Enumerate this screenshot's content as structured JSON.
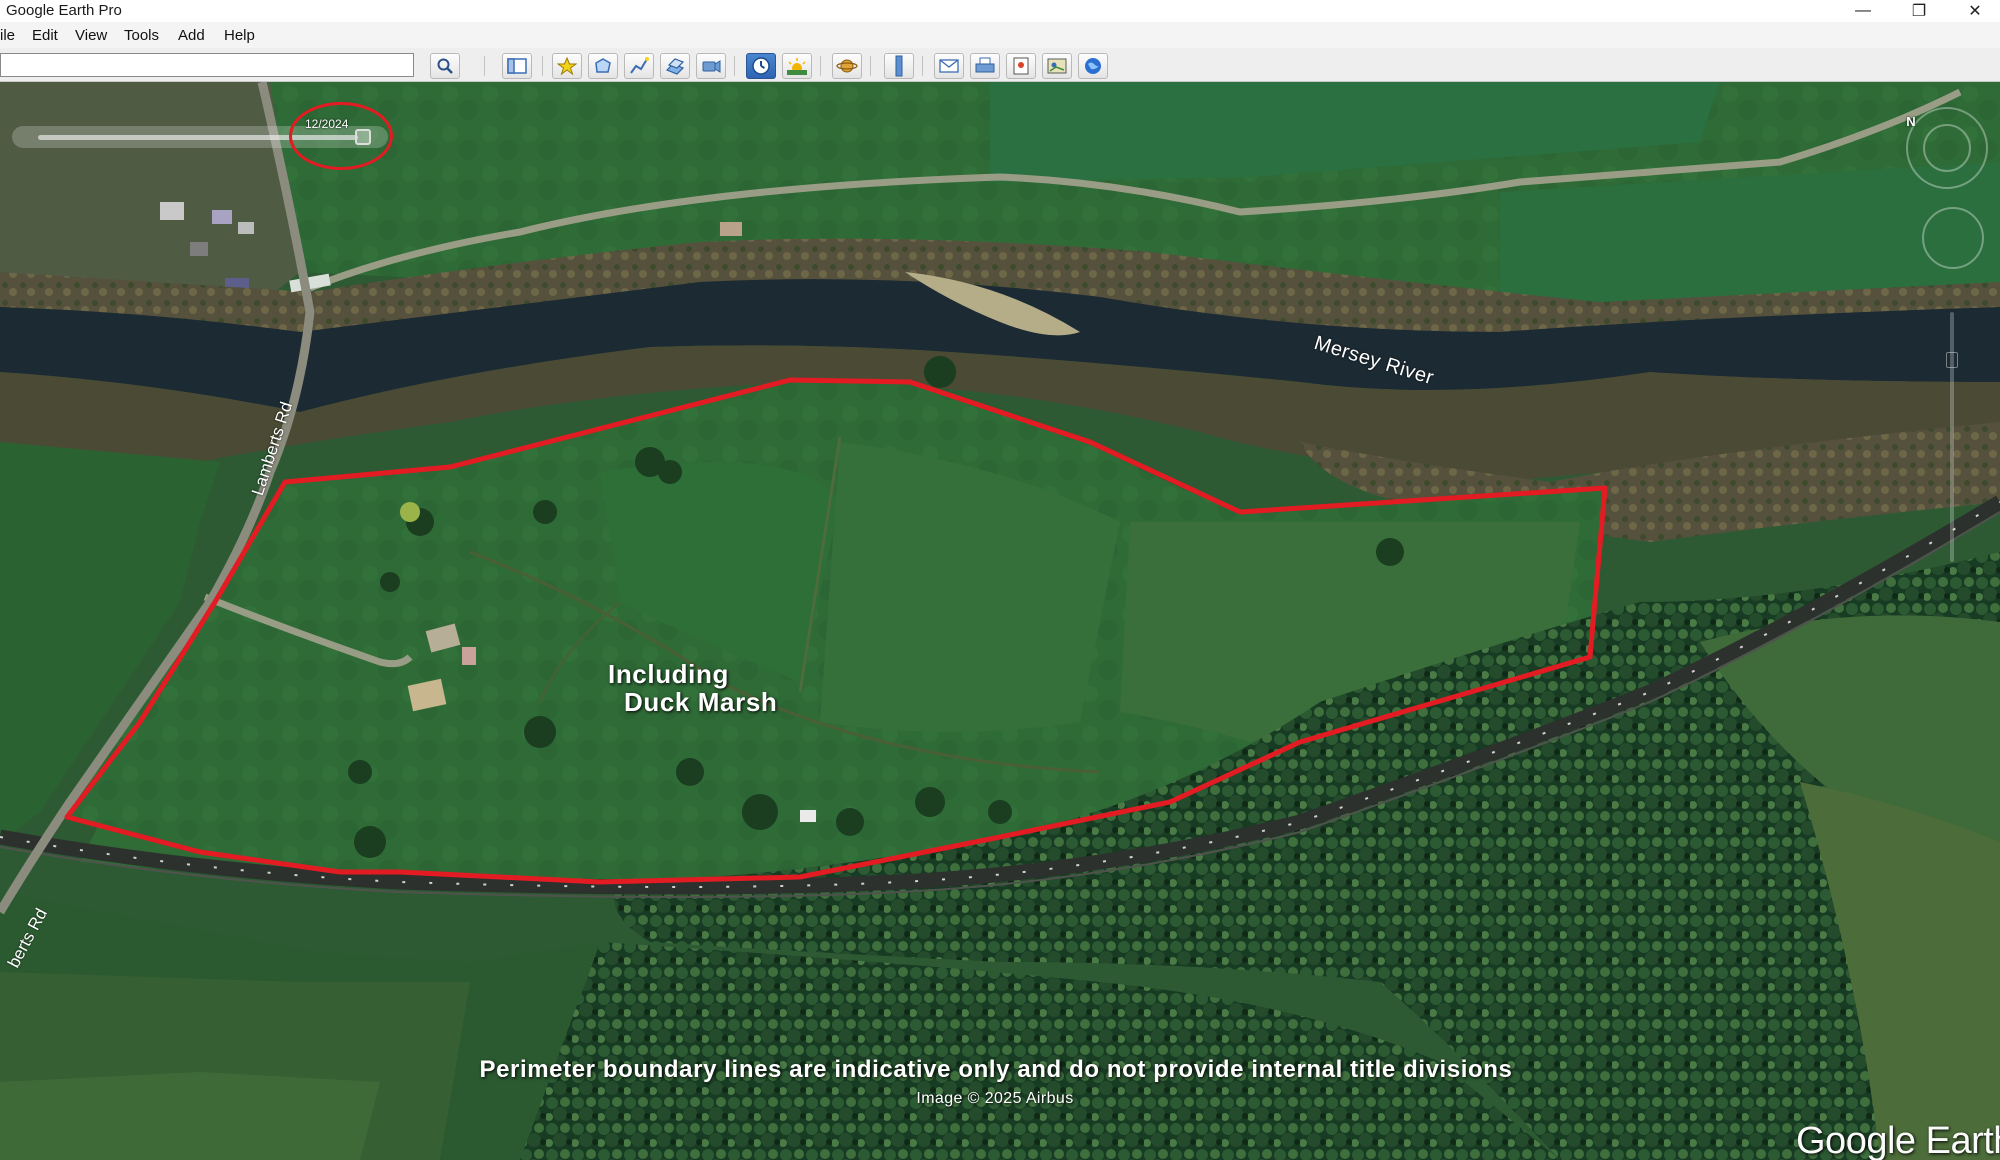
{
  "window": {
    "title": "Google Earth Pro",
    "minimize_glyph": "—",
    "maximize_glyph": "❐",
    "close_glyph": "✕"
  },
  "menu": {
    "file": "ile",
    "edit": "Edit",
    "view": "View",
    "tools": "Tools",
    "add": "Add",
    "help": "Help"
  },
  "search": {
    "value": "",
    "placeholder": ""
  },
  "toolbar": {
    "icons": [
      "search-icon",
      "sidebar-toggle-icon",
      "placemark-icon",
      "polygon-icon",
      "path-icon",
      "image-overlay-icon",
      "record-tour-icon",
      "historical-imagery-icon",
      "sunlight-icon",
      "planets-icon",
      "ruler-icon",
      "email-icon",
      "print-icon",
      "save-image-icon",
      "view-in-maps-icon",
      "earth-gallery-icon"
    ],
    "active_icon": "historical-imagery-icon"
  },
  "map": {
    "time_slider_date": "12/2024",
    "river_label": "Mersey River",
    "road_label": "Lamberts Rd",
    "road_label_cut": "berts Rd",
    "annotation_line1": "Including",
    "annotation_line2": "Duck Marsh",
    "disclaimer": "Perimeter boundary lines are indicative only and do not provide internal title divisions",
    "imagery_credit": "Image © 2025 Airbus",
    "logo": "Google Earth",
    "compass_north": "N"
  },
  "colors": {
    "boundary": "#e31b23",
    "pasture": "#2e6b35",
    "river": "#1d2b36",
    "forest": "#163a22",
    "active_tool": "#2f64b3"
  }
}
